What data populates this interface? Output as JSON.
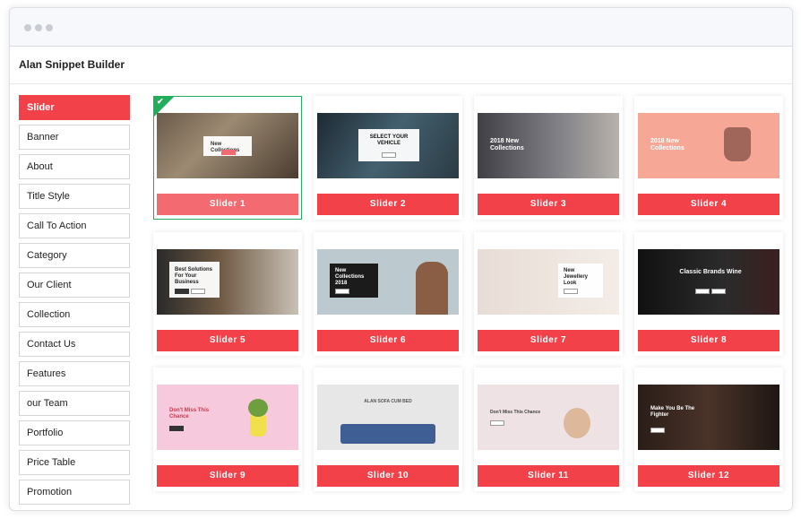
{
  "app": {
    "title": "Alan Snippet Builder"
  },
  "sidebar": {
    "items": [
      {
        "label": "Slider",
        "active": true
      },
      {
        "label": "Banner"
      },
      {
        "label": "About"
      },
      {
        "label": "Title Style"
      },
      {
        "label": "Call To Action"
      },
      {
        "label": "Category"
      },
      {
        "label": "Our Client"
      },
      {
        "label": "Collection"
      },
      {
        "label": "Contact Us"
      },
      {
        "label": "Features"
      },
      {
        "label": "our Team"
      },
      {
        "label": "Portfolio"
      },
      {
        "label": "Price Table"
      },
      {
        "label": "Promotion"
      }
    ]
  },
  "sliders": [
    {
      "label": "Slider 1",
      "selected": true,
      "thumb_text": "New Collections"
    },
    {
      "label": "Slider 2",
      "thumb_text": "SELECT YOUR VEHICLE"
    },
    {
      "label": "Slider 3",
      "thumb_text": "2018 New Collections"
    },
    {
      "label": "Slider 4",
      "thumb_text": "2018 New Collections"
    },
    {
      "label": "Slider 5",
      "thumb_text": "Best Solutions For Your Business"
    },
    {
      "label": "Slider 6",
      "thumb_text": "New Collections 2018"
    },
    {
      "label": "Slider 7",
      "thumb_text": "New Jewellery Look"
    },
    {
      "label": "Slider 8",
      "thumb_text": "Classic Brands Wine"
    },
    {
      "label": "Slider 9",
      "thumb_text": "Don't Miss This Chance"
    },
    {
      "label": "Slider 10",
      "thumb_text": "ALAN SOFA CUM BED"
    },
    {
      "label": "Slider 11",
      "thumb_text": "Don't Miss This Chance"
    },
    {
      "label": "Slider 12",
      "thumb_text": "Make You Be The Fighter"
    }
  ],
  "colors": {
    "accent": "#f24149",
    "selected_border": "#22ad5c"
  },
  "icons": {
    "selected": "check-icon"
  }
}
